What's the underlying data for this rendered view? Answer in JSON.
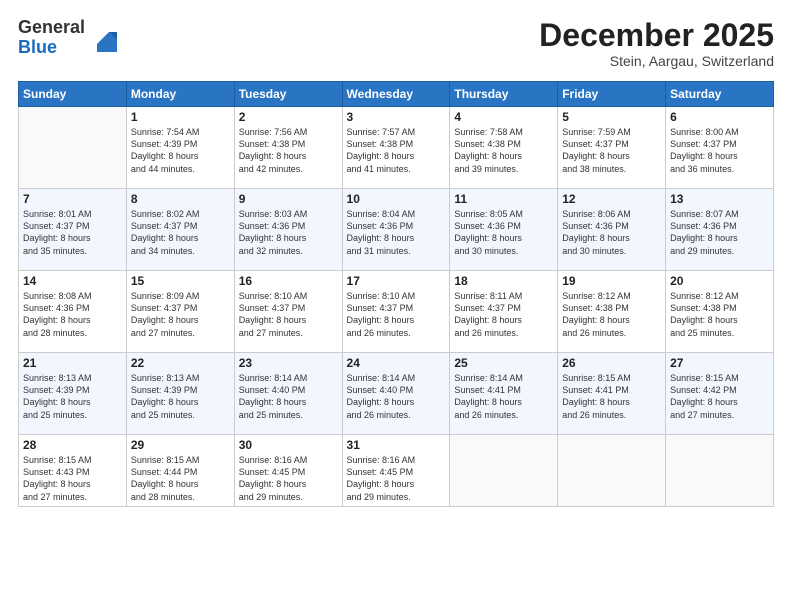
{
  "logo": {
    "general": "General",
    "blue": "Blue"
  },
  "title": "December 2025",
  "subtitle": "Stein, Aargau, Switzerland",
  "days": [
    "Sunday",
    "Monday",
    "Tuesday",
    "Wednesday",
    "Thursday",
    "Friday",
    "Saturday"
  ],
  "weeks": [
    [
      {
        "day": "",
        "info": ""
      },
      {
        "day": "1",
        "info": "Sunrise: 7:54 AM\nSunset: 4:39 PM\nDaylight: 8 hours\nand 44 minutes."
      },
      {
        "day": "2",
        "info": "Sunrise: 7:56 AM\nSunset: 4:38 PM\nDaylight: 8 hours\nand 42 minutes."
      },
      {
        "day": "3",
        "info": "Sunrise: 7:57 AM\nSunset: 4:38 PM\nDaylight: 8 hours\nand 41 minutes."
      },
      {
        "day": "4",
        "info": "Sunrise: 7:58 AM\nSunset: 4:38 PM\nDaylight: 8 hours\nand 39 minutes."
      },
      {
        "day": "5",
        "info": "Sunrise: 7:59 AM\nSunset: 4:37 PM\nDaylight: 8 hours\nand 38 minutes."
      },
      {
        "day": "6",
        "info": "Sunrise: 8:00 AM\nSunset: 4:37 PM\nDaylight: 8 hours\nand 36 minutes."
      }
    ],
    [
      {
        "day": "7",
        "info": "Sunrise: 8:01 AM\nSunset: 4:37 PM\nDaylight: 8 hours\nand 35 minutes."
      },
      {
        "day": "8",
        "info": "Sunrise: 8:02 AM\nSunset: 4:37 PM\nDaylight: 8 hours\nand 34 minutes."
      },
      {
        "day": "9",
        "info": "Sunrise: 8:03 AM\nSunset: 4:36 PM\nDaylight: 8 hours\nand 32 minutes."
      },
      {
        "day": "10",
        "info": "Sunrise: 8:04 AM\nSunset: 4:36 PM\nDaylight: 8 hours\nand 31 minutes."
      },
      {
        "day": "11",
        "info": "Sunrise: 8:05 AM\nSunset: 4:36 PM\nDaylight: 8 hours\nand 30 minutes."
      },
      {
        "day": "12",
        "info": "Sunrise: 8:06 AM\nSunset: 4:36 PM\nDaylight: 8 hours\nand 30 minutes."
      },
      {
        "day": "13",
        "info": "Sunrise: 8:07 AM\nSunset: 4:36 PM\nDaylight: 8 hours\nand 29 minutes."
      }
    ],
    [
      {
        "day": "14",
        "info": "Sunrise: 8:08 AM\nSunset: 4:36 PM\nDaylight: 8 hours\nand 28 minutes."
      },
      {
        "day": "15",
        "info": "Sunrise: 8:09 AM\nSunset: 4:37 PM\nDaylight: 8 hours\nand 27 minutes."
      },
      {
        "day": "16",
        "info": "Sunrise: 8:10 AM\nSunset: 4:37 PM\nDaylight: 8 hours\nand 27 minutes."
      },
      {
        "day": "17",
        "info": "Sunrise: 8:10 AM\nSunset: 4:37 PM\nDaylight: 8 hours\nand 26 minutes."
      },
      {
        "day": "18",
        "info": "Sunrise: 8:11 AM\nSunset: 4:37 PM\nDaylight: 8 hours\nand 26 minutes."
      },
      {
        "day": "19",
        "info": "Sunrise: 8:12 AM\nSunset: 4:38 PM\nDaylight: 8 hours\nand 26 minutes."
      },
      {
        "day": "20",
        "info": "Sunrise: 8:12 AM\nSunset: 4:38 PM\nDaylight: 8 hours\nand 25 minutes."
      }
    ],
    [
      {
        "day": "21",
        "info": "Sunrise: 8:13 AM\nSunset: 4:39 PM\nDaylight: 8 hours\nand 25 minutes."
      },
      {
        "day": "22",
        "info": "Sunrise: 8:13 AM\nSunset: 4:39 PM\nDaylight: 8 hours\nand 25 minutes."
      },
      {
        "day": "23",
        "info": "Sunrise: 8:14 AM\nSunset: 4:40 PM\nDaylight: 8 hours\nand 25 minutes."
      },
      {
        "day": "24",
        "info": "Sunrise: 8:14 AM\nSunset: 4:40 PM\nDaylight: 8 hours\nand 26 minutes."
      },
      {
        "day": "25",
        "info": "Sunrise: 8:14 AM\nSunset: 4:41 PM\nDaylight: 8 hours\nand 26 minutes."
      },
      {
        "day": "26",
        "info": "Sunrise: 8:15 AM\nSunset: 4:41 PM\nDaylight: 8 hours\nand 26 minutes."
      },
      {
        "day": "27",
        "info": "Sunrise: 8:15 AM\nSunset: 4:42 PM\nDaylight: 8 hours\nand 27 minutes."
      }
    ],
    [
      {
        "day": "28",
        "info": "Sunrise: 8:15 AM\nSunset: 4:43 PM\nDaylight: 8 hours\nand 27 minutes."
      },
      {
        "day": "29",
        "info": "Sunrise: 8:15 AM\nSunset: 4:44 PM\nDaylight: 8 hours\nand 28 minutes."
      },
      {
        "day": "30",
        "info": "Sunrise: 8:16 AM\nSunset: 4:45 PM\nDaylight: 8 hours\nand 29 minutes."
      },
      {
        "day": "31",
        "info": "Sunrise: 8:16 AM\nSunset: 4:45 PM\nDaylight: 8 hours\nand 29 minutes."
      },
      {
        "day": "",
        "info": ""
      },
      {
        "day": "",
        "info": ""
      },
      {
        "day": "",
        "info": ""
      }
    ]
  ]
}
